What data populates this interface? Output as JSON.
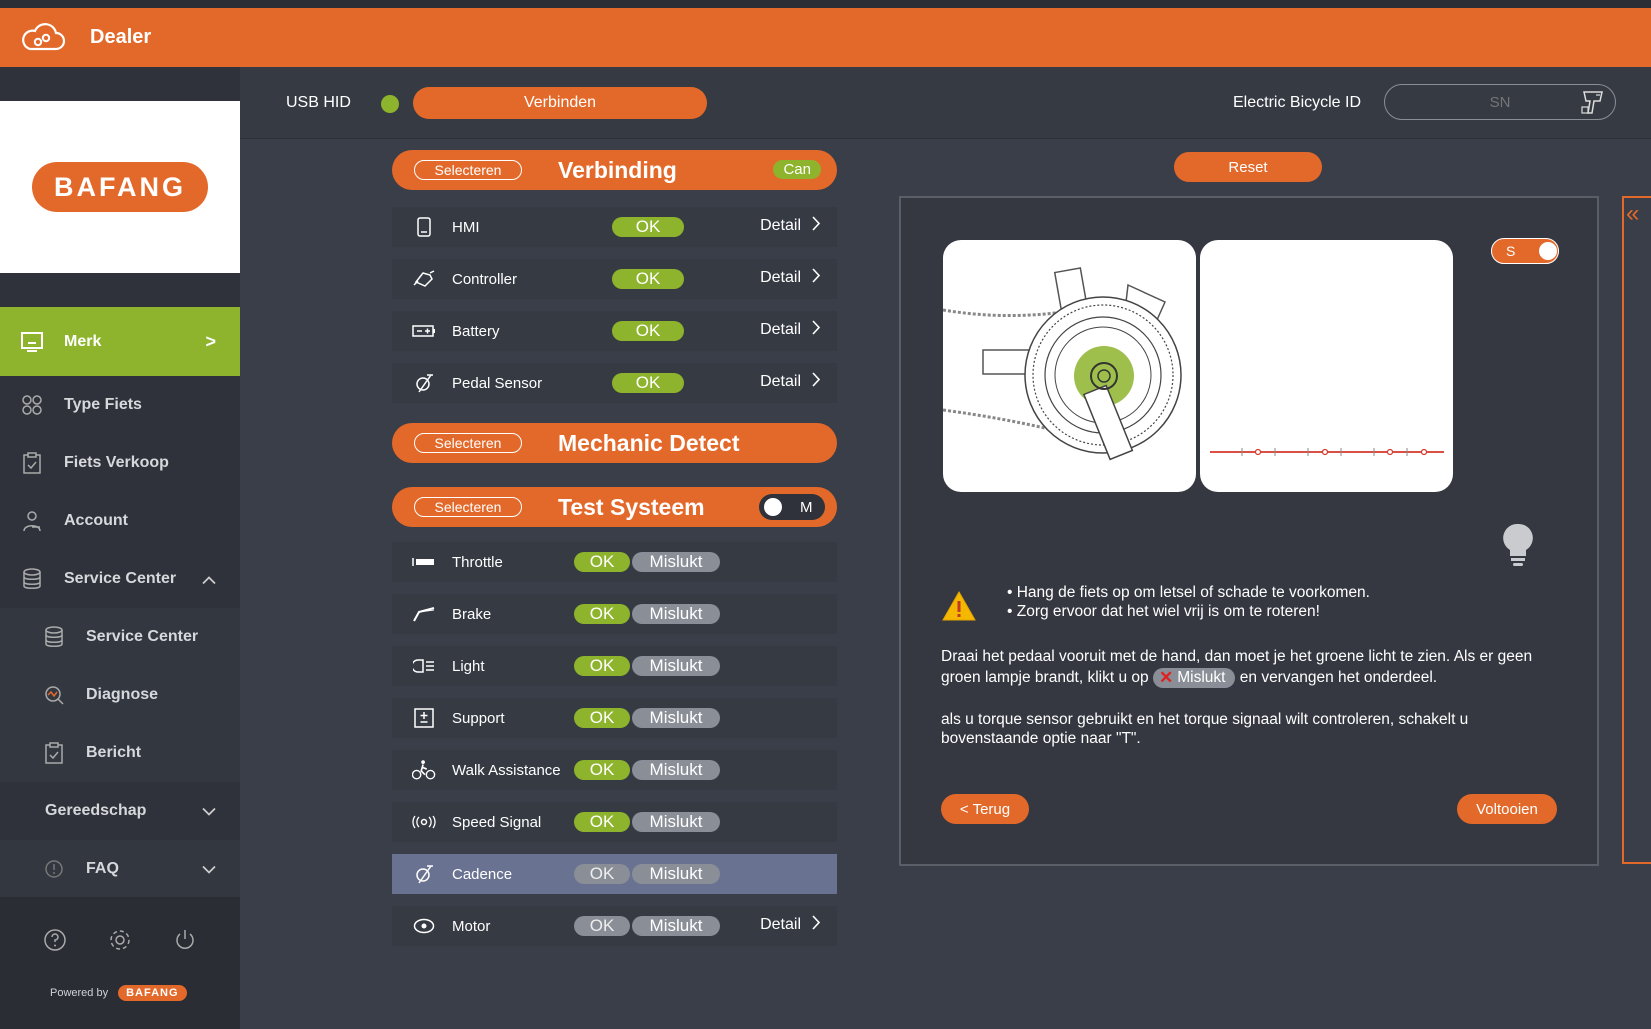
{
  "app": {
    "title": "Dealer"
  },
  "brand": {
    "logo_text": "BAFANG",
    "powered_by": "Powered by",
    "powered_logo": "BAFANG",
    "accent": "#e3692a",
    "green": "#8db42c"
  },
  "sidebar": {
    "items": [
      {
        "label": "Merk",
        "icon": "monitor-icon",
        "chevron": ">"
      },
      {
        "label": "Type Fiets",
        "icon": "grid-icon"
      },
      {
        "label": "Fiets Verkoop",
        "icon": "clipboard-icon"
      },
      {
        "label": "Account",
        "icon": "user-icon"
      },
      {
        "label": "Service Center",
        "icon": "database-icon",
        "chevron": "^"
      },
      {
        "label": "Service Center",
        "icon": "database-icon"
      },
      {
        "label": "Diagnose",
        "icon": "diagnose-icon"
      },
      {
        "label": "Bericht",
        "icon": "clipboard-icon"
      },
      {
        "label": "Gereedschap",
        "chevron": "v"
      },
      {
        "label": "FAQ",
        "icon": "info-icon",
        "chevron": "v"
      }
    ]
  },
  "connection": {
    "usb_label": "USB HID",
    "connect_label": "Verbinden",
    "ebike_label": "Electric Bicycle ID",
    "sn_placeholder": "SN"
  },
  "sections": {
    "select_label": "Selecteren",
    "verbinding": {
      "title": "Verbinding",
      "badge": "Can"
    },
    "mechanic": {
      "title": "Mechanic Detect"
    },
    "test": {
      "title": "Test Systeem",
      "toggle": "M"
    }
  },
  "verbinding_rows": [
    {
      "name": "HMI",
      "status": "OK",
      "detail": "Detail",
      "icon": "phone-icon"
    },
    {
      "name": "Controller",
      "status": "OK",
      "detail": "Detail",
      "icon": "controller-icon"
    },
    {
      "name": "Battery",
      "status": "OK",
      "detail": "Detail",
      "icon": "battery-icon"
    },
    {
      "name": "Pedal Sensor",
      "status": "OK",
      "detail": "Detail",
      "icon": "pedal-icon"
    }
  ],
  "test_rows": [
    {
      "name": "Throttle",
      "ok": "OK",
      "fail": "Mislukt",
      "icon": "throttle-icon"
    },
    {
      "name": "Brake",
      "ok": "OK",
      "fail": "Mislukt",
      "icon": "brake-icon"
    },
    {
      "name": "Light",
      "ok": "OK",
      "fail": "Mislukt",
      "icon": "light-icon"
    },
    {
      "name": "Support",
      "ok": "OK",
      "fail": "Mislukt",
      "icon": "support-icon"
    },
    {
      "name": "Walk Assistance",
      "ok": "OK",
      "fail": "Mislukt",
      "icon": "walk-assist-icon"
    },
    {
      "name": "Speed Signal",
      "ok": "OK",
      "fail": "Mislukt",
      "icon": "speed-signal-icon"
    },
    {
      "name": "Cadence",
      "ok": "OK",
      "fail": "Mislukt",
      "icon": "cadence-icon"
    },
    {
      "name": "Motor",
      "ok": "OK",
      "fail": "Mislukt",
      "detail": "Detail",
      "icon": "motor-icon"
    }
  ],
  "panel": {
    "reset_label": "Reset",
    "toggle_label": "S",
    "bullets": [
      "Hang de fiets op om letsel of schade te voorkomen.",
      "Zorg ervoor dat het wiel vrij is om te roteren!"
    ],
    "instr_a": "Draai het pedaal vooruit met de hand, dan moet je het groene licht te zien. Als er geen groen lampje brandt, klikt u op",
    "instr_fail": "Mislukt",
    "instr_b": "en vervangen het onderdeel.",
    "instr2": "als u torque sensor gebruikt en het torque signaal wilt controleren, schakelt u bovenstaande optie naar \"T\".",
    "back_label": "< Terug",
    "done_label": "Voltooien"
  }
}
